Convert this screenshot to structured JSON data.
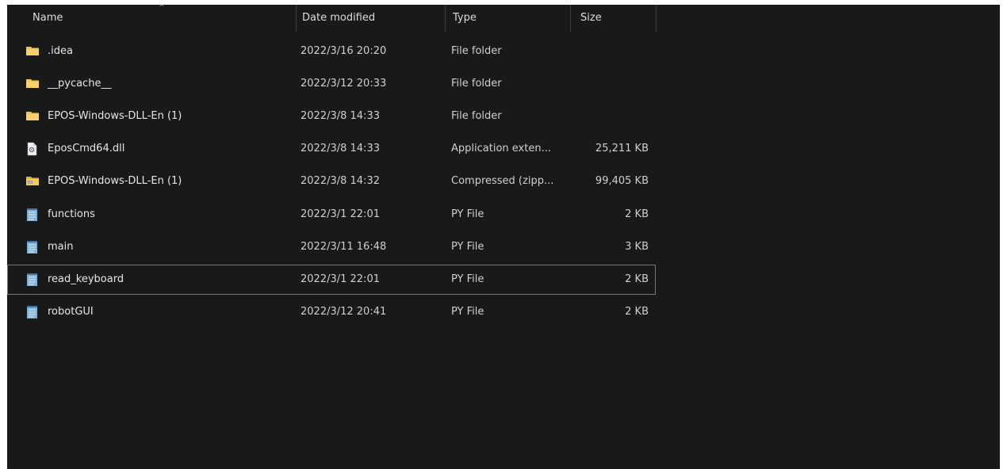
{
  "columns": {
    "name": "Name",
    "date": "Date modified",
    "type": "Type",
    "size": "Size"
  },
  "sort": {
    "column": "name",
    "indicator": "^"
  },
  "files": [
    {
      "name": ".idea",
      "date": "2022/3/16 20:20",
      "type": "File folder",
      "size": "",
      "icon": "folder-icon"
    },
    {
      "name": "__pycache__",
      "date": "2022/3/12 20:33",
      "type": "File folder",
      "size": "",
      "icon": "folder-icon"
    },
    {
      "name": "EPOS-Windows-DLL-En (1)",
      "date": "2022/3/8 14:33",
      "type": "File folder",
      "size": "",
      "icon": "folder-icon"
    },
    {
      "name": "EposCmd64.dll",
      "date": "2022/3/8 14:33",
      "type": "Application exten...",
      "size": "25,211 KB",
      "icon": "dll-file-icon"
    },
    {
      "name": "EPOS-Windows-DLL-En (1)",
      "date": "2022/3/8 14:32",
      "type": "Compressed (zipp...",
      "size": "99,405 KB",
      "icon": "zip-folder-icon"
    },
    {
      "name": "functions",
      "date": "2022/3/1 22:01",
      "type": "PY File",
      "size": "2 KB",
      "icon": "python-file-icon"
    },
    {
      "name": "main",
      "date": "2022/3/11 16:48",
      "type": "PY File",
      "size": "3 KB",
      "icon": "python-file-icon"
    },
    {
      "name": "read_keyboard",
      "date": "2022/3/1 22:01",
      "type": "PY File",
      "size": "2 KB",
      "icon": "python-file-icon",
      "selected": true
    },
    {
      "name": "robotGUI",
      "date": "2022/3/12 20:41",
      "type": "PY File",
      "size": "2 KB",
      "icon": "python-file-icon"
    }
  ],
  "colors": {
    "background": "#191919",
    "text": "#e6e6e6",
    "folder": "#f4c23d",
    "selection_border": "#777777"
  }
}
